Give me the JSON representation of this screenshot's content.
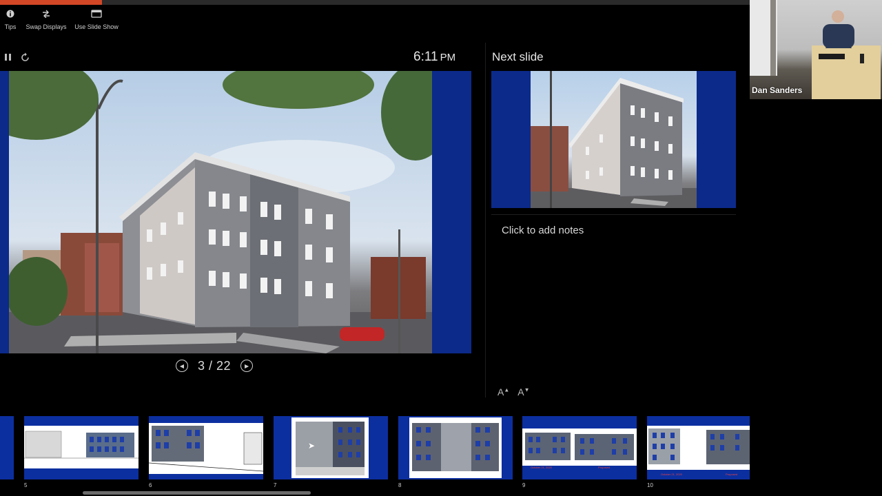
{
  "progress": {
    "fraction": 0.136,
    "color": "#d24726"
  },
  "toolbar": {
    "tips": {
      "label": "Tips",
      "icon": "info-icon"
    },
    "swap": {
      "label": "Swap Displays",
      "icon": "swap-icon"
    },
    "slideshow": {
      "label": "Use Slide Show",
      "icon": "slideshow-icon"
    }
  },
  "presenter": {
    "clock_time": "6:11",
    "clock_ampm": "PM",
    "counter": "3 / 22",
    "next_title": "Next slide",
    "notes_placeholder": "Click to add notes",
    "font_increase": "A",
    "font_decrease": "A"
  },
  "thumbnails": [
    {
      "num": "5"
    },
    {
      "num": "6"
    },
    {
      "num": "7"
    },
    {
      "num": "8"
    },
    {
      "num": "9",
      "caption_left": "October 21, 2020",
      "caption_right": "Proposed"
    },
    {
      "num": "10",
      "caption_left": "October 21, 2020",
      "caption_right": "Proposed"
    }
  ],
  "video": {
    "participant_name": "Dan Sanders"
  },
  "colors": {
    "accent": "#d24726",
    "slide_blue": "#0b2f97",
    "background": "#000000"
  }
}
